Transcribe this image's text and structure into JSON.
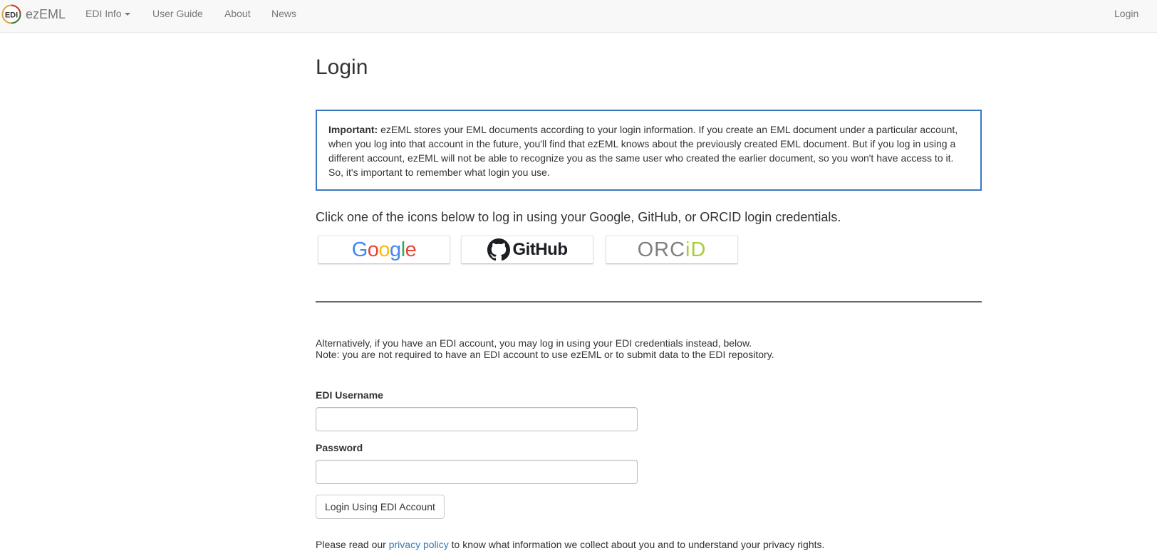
{
  "navbar": {
    "brand": "ezEML",
    "logo_text": "EDI",
    "items": [
      {
        "label": "EDI Info"
      },
      {
        "label": "User Guide"
      },
      {
        "label": "About"
      },
      {
        "label": "News"
      }
    ],
    "login": "Login"
  },
  "page": {
    "title": "Login",
    "important": {
      "label": "Important:",
      "text": " ezEML stores your EML documents according to your login information. If you create an EML document under a particular account, when you log into that account in the future, you'll find that ezEML knows about the previously created EML document. But if you log in using a different account, ezEML will not be able to recognize you as the same user who created the earlier document, so you won't have access to it. So, it's important to remember what login you use."
    },
    "oauth_intro": "Click one of the icons below to log in using your Google, GitHub, or ORCID login credentials.",
    "providers": {
      "google": "Google",
      "github": "GitHub",
      "orcid_main": "ORC",
      "orcid_id": "iD"
    },
    "alt_line1": "Alternatively, if you have an EDI account, you may log in using your EDI credentials instead, below.",
    "alt_line2": "Note: you are not required to have an EDI account to use ezEML or to submit data to the EDI repository.",
    "form": {
      "username_label": "EDI Username",
      "username_value": "",
      "password_label": "Password",
      "password_value": "",
      "submit": "Login Using EDI Account"
    },
    "privacy": {
      "before": "Please read our ",
      "link": "privacy policy",
      "after": " to know what information we collect about you and to understand your privacy rights."
    }
  },
  "colors": {
    "navbar_bg": "#f8f8f8",
    "important_border": "#3a77c0",
    "link": "#337ab7",
    "google_blue": "#4285f4",
    "google_red": "#ea4335",
    "google_yellow": "#fbbc05",
    "google_green": "#34a853",
    "orcid_green": "#a6ce39"
  }
}
